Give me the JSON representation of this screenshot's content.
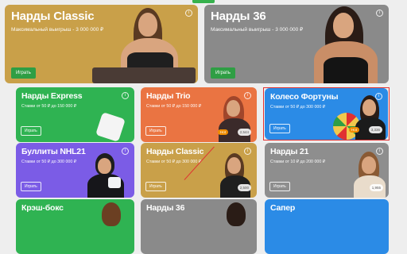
{
  "cards": {
    "nardy_classic_big": {
      "title": "Нарды Classic",
      "subtitle": "Максимальный выигрыш - 3 000 000 ₽",
      "play": "Играть"
    },
    "nardy_36_big": {
      "title": "Нарды 36",
      "subtitle": "Максимальный выигрыш - 3 000 000 ₽",
      "play": "Играть"
    },
    "nardy_express": {
      "title": "Нарды Express",
      "subtitle": "Ставки от 50 ₽ до 150 000 ₽",
      "play": "Играть"
    },
    "nardy_trio": {
      "title": "Нарды Trio",
      "subtitle": "Ставки от 50 ₽ до 150 000 ₽",
      "play": "Играть",
      "badge": "Hot",
      "players": "2,544"
    },
    "koleso_fortuny": {
      "title": "Колесо Фортуны",
      "subtitle": "Ставки от 50 ₽ до 300 000 ₽",
      "play": "Играть",
      "badge": "Hot",
      "players": "3,336"
    },
    "bullity_nhl21": {
      "title": "Буллиты NHL21",
      "subtitle": "Ставки от 50 ₽ до 300 000 ₽",
      "play": "Играть"
    },
    "nardy_classic_small": {
      "title": "Нарды Classic",
      "subtitle": "Ставки от 50 ₽ до 300 000 ₽",
      "play": "Играть",
      "players": "2,500"
    },
    "nardy_21": {
      "title": "Нарды 21",
      "subtitle": "Ставки от 10 ₽ до 200 000 ₽",
      "play": "Играть",
      "players": "1,955"
    },
    "kresh_boks": {
      "title": "Крэш-бокс"
    },
    "nardy_36_small": {
      "title": "Нарды 36"
    },
    "saper": {
      "title": "Сапер"
    }
  },
  "info_glyph": "i",
  "colors": {
    "gold": "#c9a049",
    "grey": "#8a8a8a",
    "green": "#2fb352",
    "orange": "#ea7442",
    "blue": "#2b8be6",
    "purple": "#7b5ce6",
    "gold2": "#c9a049",
    "grey2": "#8e8e8e",
    "play_green": "#2f9e44",
    "selection": "#e03131"
  }
}
